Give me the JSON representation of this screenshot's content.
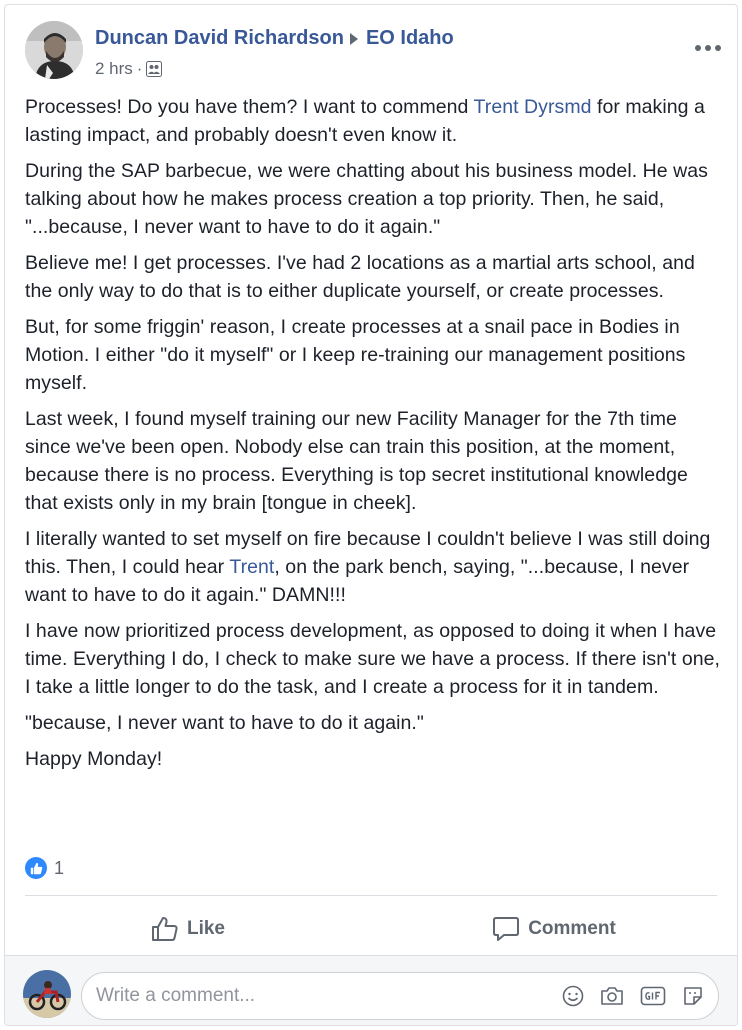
{
  "post": {
    "author": "Duncan David Richardson",
    "group": "EO Idaho",
    "time": "2 hrs",
    "separator": "·",
    "paragraphs": [
      [
        {
          "t": "Processes! Do you have them? I want to commend "
        },
        {
          "t": "Trent Dyrsmd",
          "link": true
        },
        {
          "t": " for making a lasting impact, and probably doesn't even know it."
        }
      ],
      [
        {
          "t": "During the SAP barbecue, we were chatting about his business model. He was talking about how he makes process creation a top priority. Then, he said, \"...because, I never want to have to do it again.\""
        }
      ],
      [
        {
          "t": "Believe me! I get processes. I've had 2 locations as a martial arts school, and the only way to do that is to either duplicate yourself, or create processes."
        }
      ],
      [
        {
          "t": "But, for some friggin' reason, I create processes at a snail pace in Bodies in Motion. I either \"do it myself\" or I keep re-training our management positions myself."
        }
      ],
      [
        {
          "t": "Last week, I found myself training our new Facility Manager for the 7th time since we've been open. Nobody else can train this position, at the moment, because there is no process. Everything is top secret institutional knowledge that exists only in my brain [tongue in cheek]."
        }
      ],
      [
        {
          "t": "I literally wanted to set myself on fire because I couldn't believe I was still doing this. Then, I could hear "
        },
        {
          "t": "Trent",
          "link": true
        },
        {
          "t": ", on the park bench, saying, \"...because, I never want to have to do it again.\" DAMN!!!"
        }
      ],
      [
        {
          "t": "I have now prioritized process development, as opposed to doing it when I have time. Everything I do, I check to make sure we have a process. If there isn't one, I take a little longer to do the task, and I create a process for it in tandem."
        }
      ],
      [
        {
          "t": "\"because, I never want to have to do it again.\""
        }
      ],
      [
        {
          "t": "Happy Monday!"
        }
      ]
    ]
  },
  "reactions": {
    "count": "1",
    "icon": "like-reaction-icon"
  },
  "actions": {
    "like_label": "Like",
    "comment_label": "Comment"
  },
  "comment": {
    "placeholder": "Write a comment..."
  },
  "colors": {
    "link": "#385898",
    "text": "#1d2129",
    "muted": "#606770",
    "like_blue": "#2e89ff"
  }
}
